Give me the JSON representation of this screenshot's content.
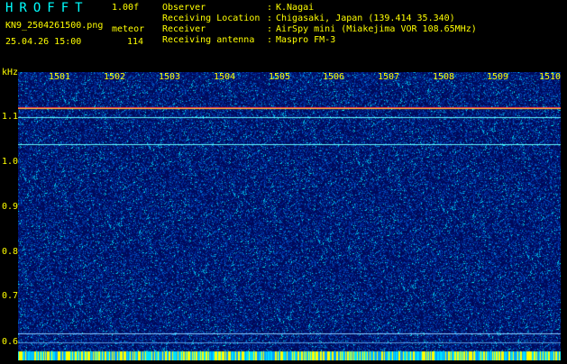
{
  "header": {
    "title": "HROFFT",
    "version": "1.00f",
    "filename": "KN9_2504261500.png",
    "datetime": "25.04.26 15:00",
    "mode": "meteor",
    "count": "114"
  },
  "info": [
    {
      "key": "Observer",
      "value": "K.Nagai"
    },
    {
      "key": "Receiving Location",
      "value": "Chigasaki, Japan (139.414 35.340)"
    },
    {
      "key": "Receiver",
      "value": "AirSpy mini (Miakejima VOR 108.65MHz)"
    },
    {
      "key": "Receiving antenna",
      "value": "Maspro FM-3"
    }
  ],
  "axes": {
    "unit": "kHz",
    "y_ticks": [
      "1.1",
      "1.0",
      "0.9",
      "0.8",
      "0.7",
      "0.6"
    ],
    "x_ticks": [
      "1501",
      "1502",
      "1503",
      "1504",
      "1505",
      "1506",
      "1507",
      "1508",
      "1509",
      "1510"
    ]
  },
  "colors": {
    "label": "#ffff00",
    "title": "#00ffff",
    "background": "#000000",
    "noise_base": "#001a66"
  }
}
